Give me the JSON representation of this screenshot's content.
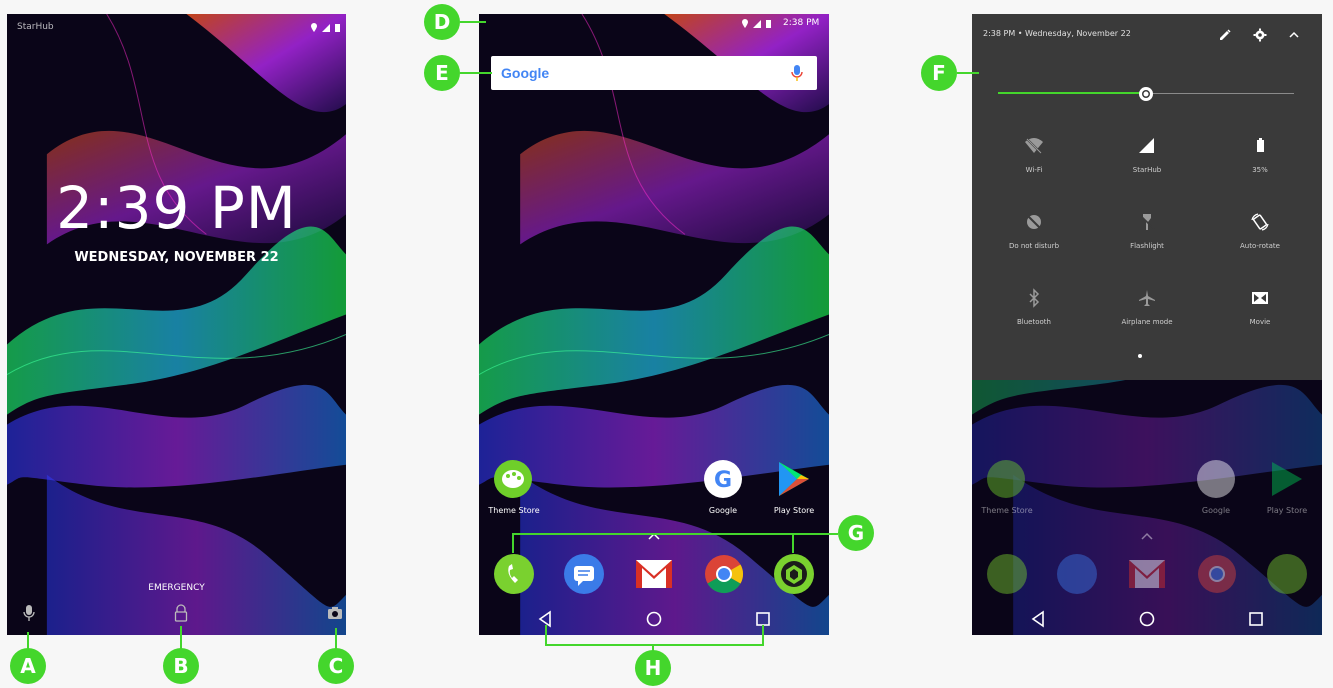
{
  "lock_screen": {
    "carrier": "StarHub",
    "time": "2:39 PM",
    "date": "WEDNESDAY, NOVEMBER 22",
    "emergency": "EMERGENCY"
  },
  "home_screen": {
    "status_time": "2:38 PM",
    "search_logo": "Google",
    "apps": [
      "Theme Store",
      "Google",
      "Play Store"
    ],
    "dock": [
      "phone-icon",
      "messages-icon",
      "gmail-icon",
      "chrome-icon",
      "cortex-icon"
    ]
  },
  "quick_settings": {
    "header": "2:38 PM • Wednesday, November 22",
    "tiles": [
      "Wi-Fi",
      "StarHub",
      "35%",
      "Do not disturb",
      "Flashlight",
      "Auto-rotate",
      "Bluetooth",
      "Airplane mode",
      "Movie"
    ],
    "brightness": 0.5,
    "apps": [
      "Theme Store",
      "Google",
      "Play Store"
    ]
  },
  "callouts": [
    "A",
    "B",
    "C",
    "D",
    "E",
    "F",
    "G",
    "H"
  ],
  "colors": {
    "accent": "#44d62c",
    "panel": "#3a3a3a"
  }
}
